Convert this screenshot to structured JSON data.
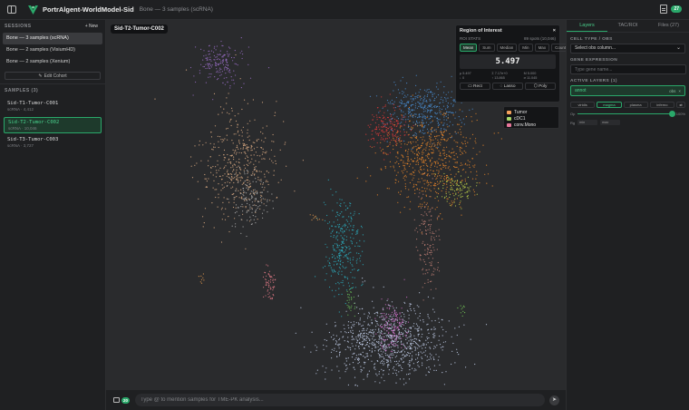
{
  "app": {
    "title": "PortrAlgent-WorldModel-Sid",
    "subtitle": "Bone — 3 samples (scRNA)",
    "notification_count": "27"
  },
  "sessions": {
    "label": "SESSIONS",
    "new_label": "+ New",
    "items": [
      {
        "label": "Bone — 3 samples (scRNA)"
      },
      {
        "label": "Bone — 2 samples (VisiumHD)"
      },
      {
        "label": "Bone — 2 samples (Xenium)"
      }
    ],
    "edit_cohort_label": "Edit Cohort"
  },
  "samples": {
    "label": "SAMPLES (3)",
    "items": [
      {
        "name": "Sid-T1-Tumor-C001",
        "meta": "scRNA · 4,412"
      },
      {
        "name": "Sid-T2-Tumor-C002",
        "meta": "scRNA · 10,046"
      },
      {
        "name": "Sid-T3-Tumor-C003",
        "meta": "scRNA · 3,727"
      }
    ]
  },
  "canvas": {
    "sample_label": "Sid-T2-Tumor-C002"
  },
  "roi": {
    "title": "Region of Interest",
    "close": "×",
    "stats_label": "ROI STATS",
    "spots": "89 spots (10,046)",
    "tabs": [
      "Mean",
      "Sum",
      "Median",
      "Min",
      "Max",
      "Count"
    ],
    "value": "5.497",
    "stats": [
      "μ 5.497",
      "Σ 7.17e+0",
      "M 5.000",
      "↓ 0",
      "↑ 13.865",
      "σ 11.045"
    ],
    "tools": [
      "▭ Rect",
      "◌ Lasso",
      "⬡ Poly"
    ]
  },
  "legend": [
    {
      "label": "Tumor",
      "color": "#f5a05c"
    },
    {
      "label": "cDC1",
      "color": "#a8d86a"
    },
    {
      "label": "conv.Mono",
      "color": "#e8779a"
    }
  ],
  "chat": {
    "count": "20",
    "placeholder": "Type @ to mention samples for TME-PK analysis...",
    "send": "➤"
  },
  "right_panel": {
    "tabs": [
      "Layers",
      "TAC/ROI",
      "Files (27)"
    ],
    "cell_type_label": "CELL TYPE / OBS",
    "cell_type_value": "Select obs column...",
    "gene_label": "GENE EXPRESSION",
    "gene_placeholder": "Type gene name...",
    "active_layers_label": "ACTIVE LAYERS (1)",
    "layer_name": "annot",
    "layer_kind": "obs",
    "layer_close": "×",
    "cmaps": [
      "viridis",
      "magma",
      "plasma",
      "inferno"
    ],
    "cmap_icon": "⇄",
    "opacity_label": "Op",
    "opacity_value": "100%",
    "range_label": "Rg",
    "range_min": "min",
    "range_max": "max"
  },
  "colors": {
    "accent": "#2aa86a",
    "background": "#1b1c1e"
  }
}
